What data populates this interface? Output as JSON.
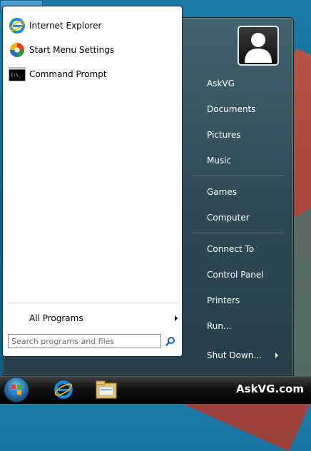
{
  "pinned": [
    {
      "label": "Internet Explorer",
      "icon": "internet-explorer-icon"
    },
    {
      "label": "Start Menu Settings",
      "icon": "settings-icon"
    },
    {
      "label": "Command Prompt",
      "icon": "command-prompt-icon"
    }
  ],
  "all_programs_label": "All Programs",
  "search": {
    "placeholder": "Search programs and files"
  },
  "right_items": [
    "AskVG",
    "Documents",
    "Pictures",
    "Music",
    "Games",
    "Computer",
    "Connect To",
    "Control Panel",
    "Printers",
    "Run..."
  ],
  "shutdown_label": "Shut Down...",
  "brand": "AskVG.com",
  "colors": {
    "accent": "#2c76b0",
    "ie_blue": "#1e8bd8",
    "desktop_red": "#d24b33"
  }
}
